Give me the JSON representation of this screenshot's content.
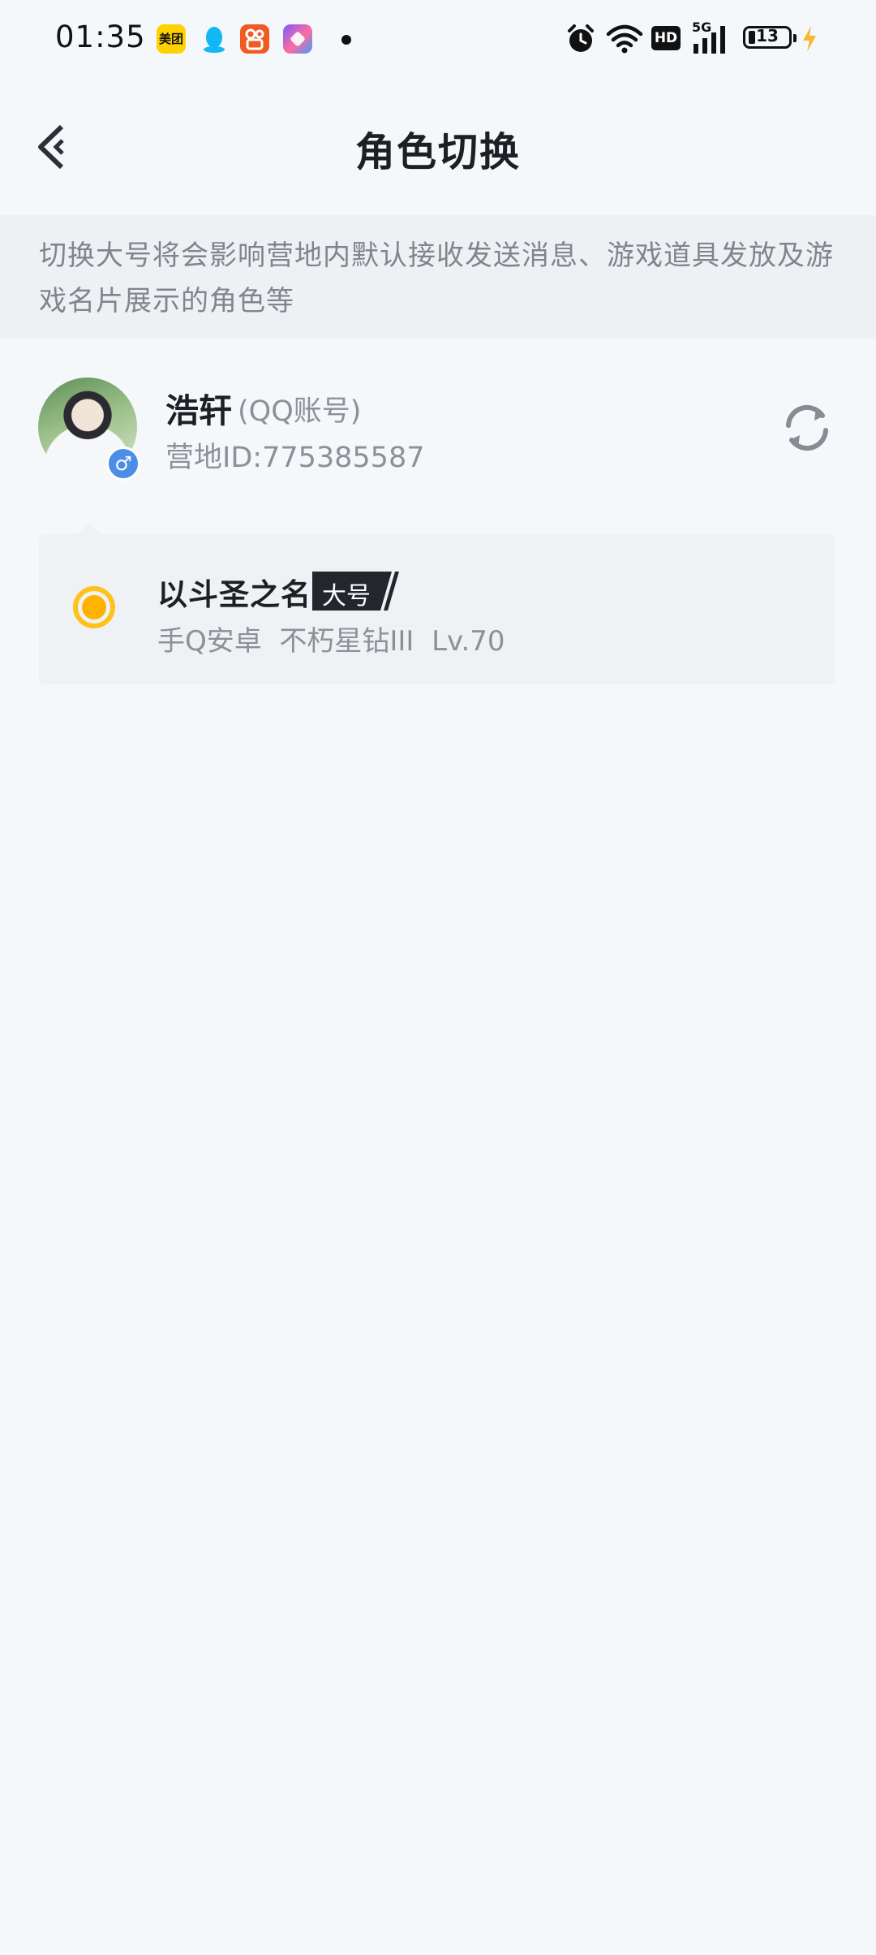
{
  "status_bar": {
    "time": "01:35",
    "apps": [
      "meituan-icon",
      "qq-icon",
      "kuaishou-icon",
      "shortcut-icon"
    ],
    "meituan_label": "美团",
    "hd_label": "HD",
    "network_label": "5G",
    "battery_level": "13"
  },
  "header": {
    "title": "角色切换",
    "back_icon": "chevron-left-icon"
  },
  "notice": {
    "text": "切换大号将会影响营地内默认接收发送消息、游戏道具发放及游戏名片展示的角色等"
  },
  "account": {
    "name": "浩轩",
    "type": "(QQ账号)",
    "camp_id": "营地ID:775385587",
    "gender_icon": "male-icon",
    "gender_symbol": "♂"
  },
  "role": {
    "name": "以斗圣之名",
    "badge": "大号",
    "meta": "手Q安卓  不朽星钻III  Lv.70",
    "selected": true
  },
  "colors": {
    "background": "#f5f8fb",
    "notice_bg": "#eef1f4",
    "accent_yellow": "#ffb300",
    "badge_dark": "#23262d",
    "gender_blue": "#4a8ee8"
  }
}
